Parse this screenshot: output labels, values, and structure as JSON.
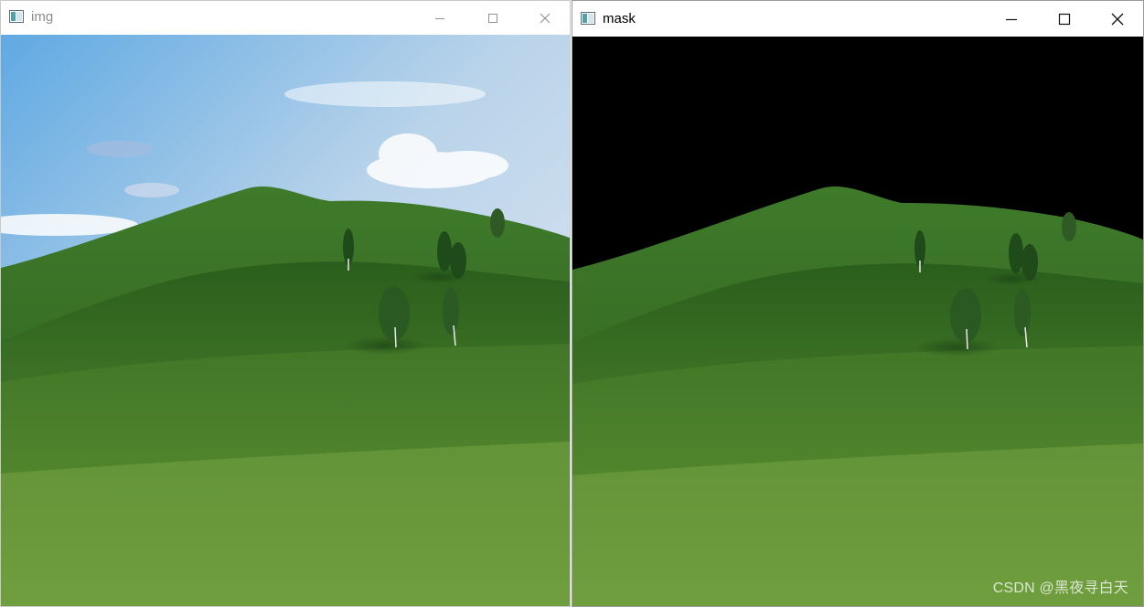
{
  "windows": {
    "img": {
      "title": "img"
    },
    "mask": {
      "title": "mask"
    }
  },
  "icons": {
    "app": "opencv-window-icon",
    "minimize": "minimize-icon",
    "maximize": "maximize-icon",
    "close": "close-icon"
  },
  "watermark": "CSDN @黑夜寻白天",
  "colors": {
    "mask_background": "#000000",
    "sky_top": "#6fb3e6",
    "grass_light": "#6f9c38",
    "grass_dark": "#2c5f1c"
  }
}
